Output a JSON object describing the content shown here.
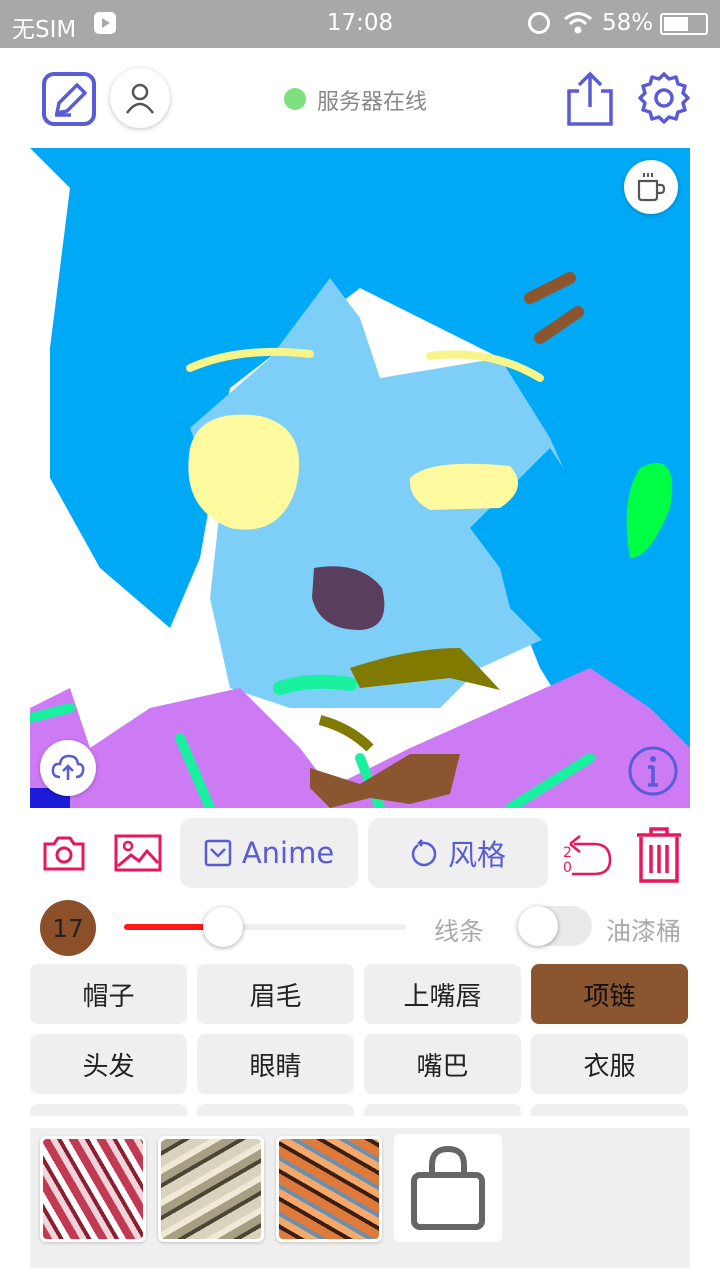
{
  "status_bar": {
    "carrier": "无SIM",
    "time": "17:08",
    "battery": "58%"
  },
  "header": {
    "server_status": "服务器在线",
    "server_status_color": "#7fe07f",
    "icons": [
      "edit-icon",
      "user-icon",
      "share-icon",
      "settings-icon"
    ]
  },
  "canvas_overlay": {
    "icons": [
      "coffee-icon",
      "cloud-upload-icon",
      "info-icon"
    ]
  },
  "toolbar": {
    "anime_label": "Anime",
    "style_label": "风格",
    "undo_count": "20",
    "icons": [
      "camera-icon",
      "image-icon",
      "check-box-icon",
      "rotate-icon",
      "undo-icon",
      "trash-icon"
    ]
  },
  "brush": {
    "size": "17",
    "size_color": "#8b4f2a",
    "slider_fraction": 0.35,
    "line_label": "线条",
    "bucket_label": "油漆桶",
    "bucket_enabled": false
  },
  "parts": {
    "row1": [
      "帽子",
      "眉毛",
      "上嘴唇",
      "项链"
    ],
    "row2": [
      "头发",
      "眼睛",
      "嘴巴",
      "衣服"
    ],
    "active": "项链",
    "active_color": "#8b5530"
  },
  "styles": {
    "icons": [
      "shopping-bag-icon"
    ],
    "thumb_colors": [
      "#c23a52",
      "#8a8060",
      "#e07a3a"
    ]
  }
}
